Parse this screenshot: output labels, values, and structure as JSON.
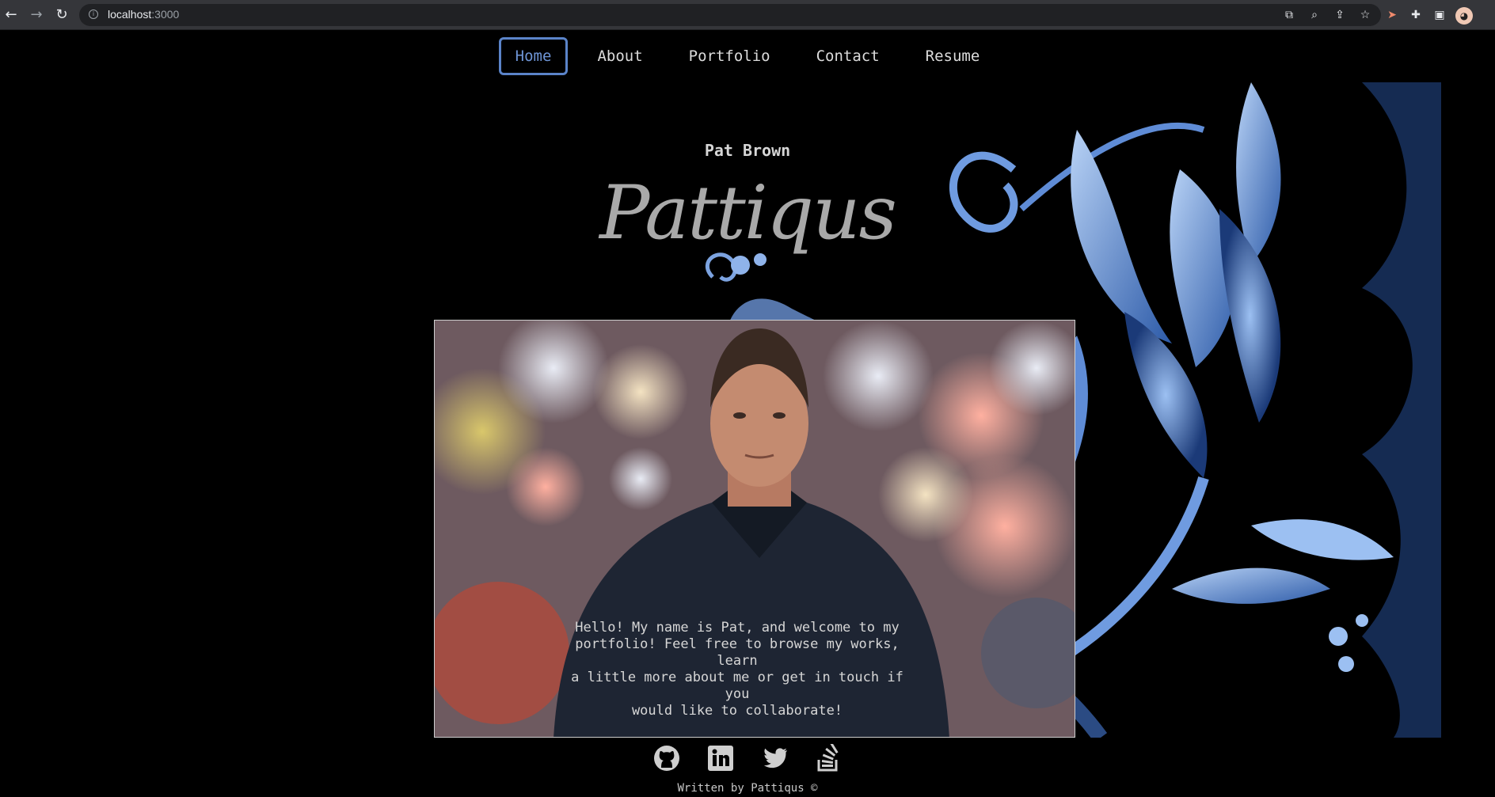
{
  "browser": {
    "url_host": "localhost",
    "url_port": ":3000",
    "back_icon": "back-arrow-icon",
    "forward_icon": "forward-arrow-icon",
    "reload_icon": "reload-icon"
  },
  "nav": {
    "items": [
      {
        "label": "Home",
        "active": true
      },
      {
        "label": "About"
      },
      {
        "label": "Portfolio"
      },
      {
        "label": "Contact"
      },
      {
        "label": "Resume"
      }
    ],
    "active_color": "#5b84c9"
  },
  "header": {
    "author": "Pat Brown",
    "signature": "Pattiqus"
  },
  "hero": {
    "text": "Hello! My name is Pat, and welcome to my\nportfolio! Feel free to browse my works, learn\na little more about me or get in touch if you\nwould like to collaborate!"
  },
  "social": [
    {
      "icon": "github-icon"
    },
    {
      "icon": "linkedin-icon"
    },
    {
      "icon": "twitter-icon"
    },
    {
      "icon": "stackoverflow-icon"
    }
  ],
  "footer": {
    "text": "Written by Pattiqus ©"
  }
}
